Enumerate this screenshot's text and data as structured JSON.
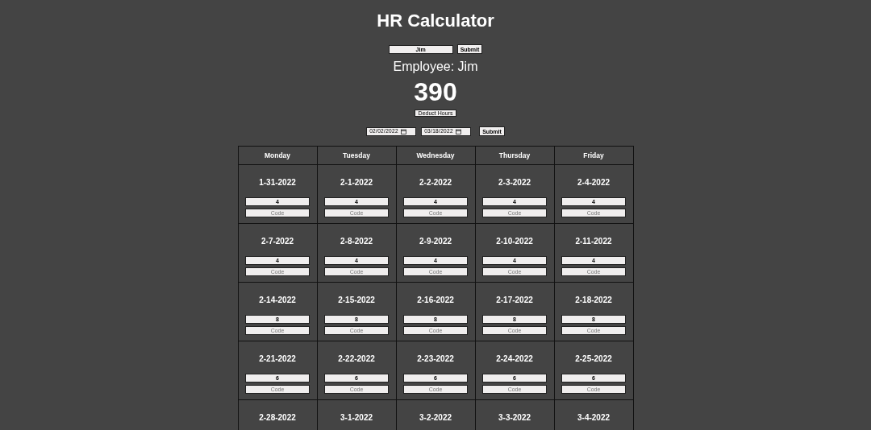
{
  "title": "HR Calculator",
  "name_field": {
    "value": "Jim"
  },
  "submit_button": "Submit",
  "employee_label": "Employee: Jim",
  "total_hours": "390",
  "deduct_button": "Deduct Hours",
  "date_range": {
    "start": "02/02/2022",
    "end": "03/18/2022",
    "submit": "Submit"
  },
  "table": {
    "columns": [
      "Monday",
      "Tuesday",
      "Wednesday",
      "Thursday",
      "Friday"
    ],
    "rows": [
      [
        {
          "date": "1-31-2022",
          "hours": "4",
          "code_placeholder": "Code"
        },
        {
          "date": "2-1-2022",
          "hours": "4",
          "code_placeholder": "Code"
        },
        {
          "date": "2-2-2022",
          "hours": "4",
          "code_placeholder": "Code"
        },
        {
          "date": "2-3-2022",
          "hours": "4",
          "code_placeholder": "Code"
        },
        {
          "date": "2-4-2022",
          "hours": "4",
          "code_placeholder": "Code"
        }
      ],
      [
        {
          "date": "2-7-2022",
          "hours": "4",
          "code_placeholder": "Code"
        },
        {
          "date": "2-8-2022",
          "hours": "4",
          "code_placeholder": "Code"
        },
        {
          "date": "2-9-2022",
          "hours": "4",
          "code_placeholder": "Code"
        },
        {
          "date": "2-10-2022",
          "hours": "4",
          "code_placeholder": "Code"
        },
        {
          "date": "2-11-2022",
          "hours": "4",
          "code_placeholder": "Code"
        }
      ],
      [
        {
          "date": "2-14-2022",
          "hours": "8",
          "code_placeholder": "Code"
        },
        {
          "date": "2-15-2022",
          "hours": "8",
          "code_placeholder": "Code"
        },
        {
          "date": "2-16-2022",
          "hours": "8",
          "code_placeholder": "Code"
        },
        {
          "date": "2-17-2022",
          "hours": "8",
          "code_placeholder": "Code"
        },
        {
          "date": "2-18-2022",
          "hours": "8",
          "code_placeholder": "Code"
        }
      ],
      [
        {
          "date": "2-21-2022",
          "hours": "6",
          "code_placeholder": "Code"
        },
        {
          "date": "2-22-2022",
          "hours": "6",
          "code_placeholder": "Code"
        },
        {
          "date": "2-23-2022",
          "hours": "6",
          "code_placeholder": "Code"
        },
        {
          "date": "2-24-2022",
          "hours": "6",
          "code_placeholder": "Code"
        },
        {
          "date": "2-25-2022",
          "hours": "6",
          "code_placeholder": "Code"
        }
      ],
      [
        {
          "date": "2-28-2022"
        },
        {
          "date": "3-1-2022"
        },
        {
          "date": "3-2-2022"
        },
        {
          "date": "3-3-2022"
        },
        {
          "date": "3-4-2022"
        }
      ]
    ]
  }
}
